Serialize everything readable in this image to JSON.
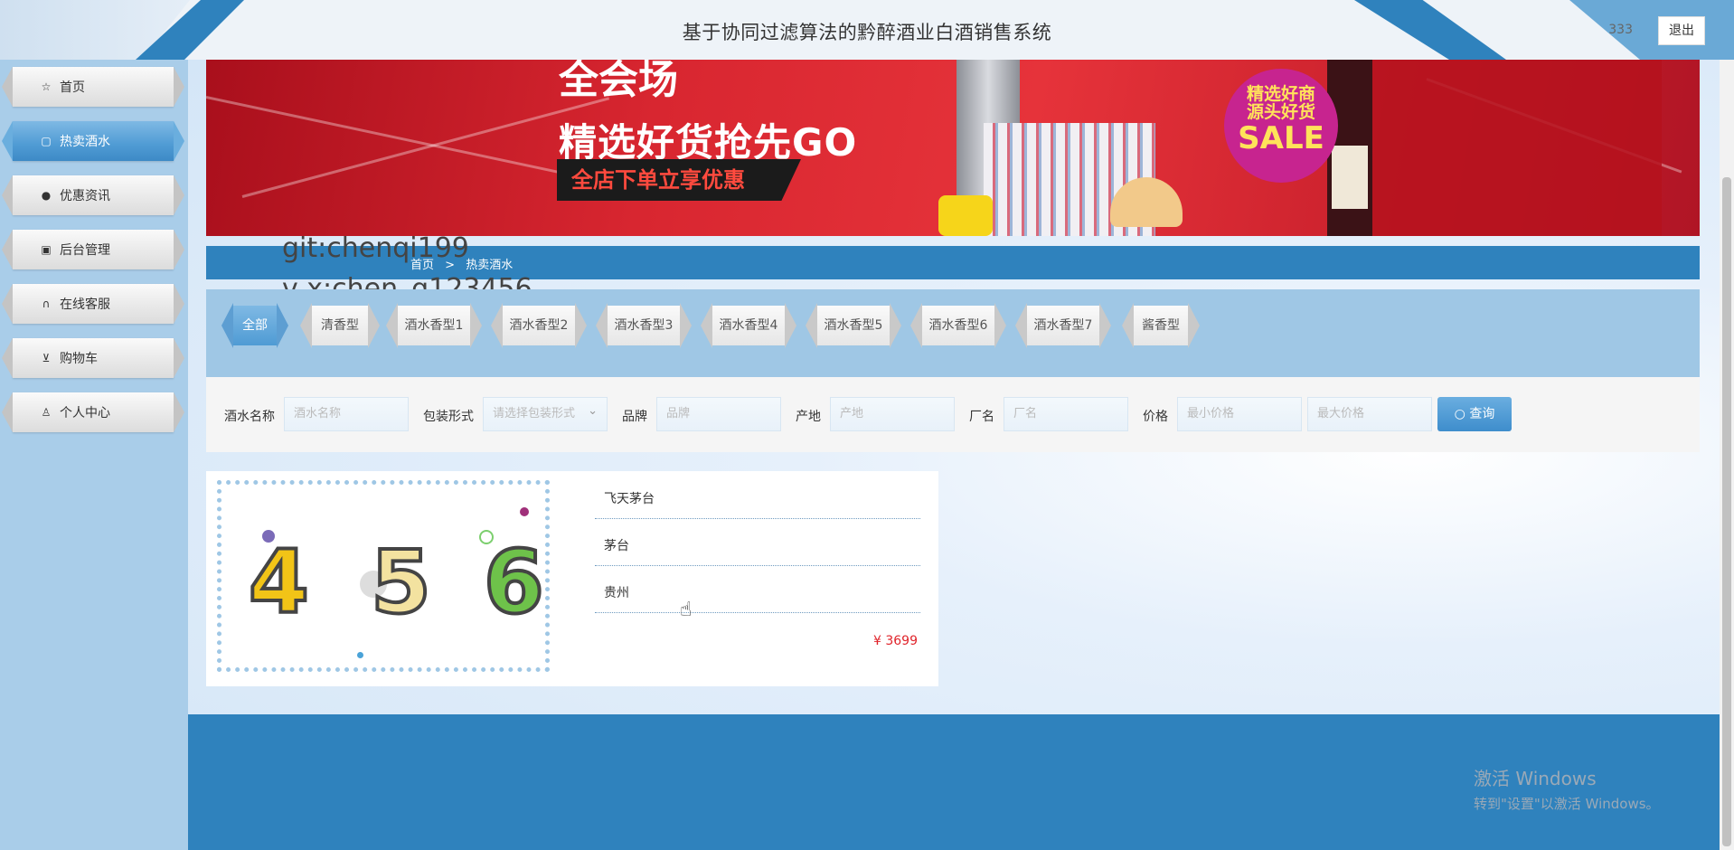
{
  "header": {
    "title": "基于协同过滤算法的黔醉酒业白酒销售系统",
    "username": "333",
    "logout_label": "退出"
  },
  "sidebar": {
    "items": [
      {
        "label": "首页",
        "icon": "star-icon",
        "active": false
      },
      {
        "label": "热卖酒水",
        "icon": "bag-icon",
        "active": true
      },
      {
        "label": "优惠资讯",
        "icon": "info-icon",
        "active": false
      },
      {
        "label": "后台管理",
        "icon": "gift-icon",
        "active": false
      },
      {
        "label": "在线客服",
        "icon": "headset-icon",
        "active": false
      },
      {
        "label": "购物车",
        "icon": "cart-icon",
        "active": false
      },
      {
        "label": "个人中心",
        "icon": "user-icon",
        "active": false
      }
    ]
  },
  "banner": {
    "line1": "全会场",
    "line2": "精选好货抢先GO",
    "tag": "全店下单立享优惠",
    "sale_line1": "精选好商",
    "sale_line2": "源头好货",
    "sale_line3": "SALE"
  },
  "breadcrumb": {
    "home": "首页",
    "separator": ">",
    "current": "热卖酒水"
  },
  "watermark": {
    "line1": "git:chenqi199",
    "line2": "v x:chen_q123456"
  },
  "tabs": [
    {
      "label": "全部",
      "active": true
    },
    {
      "label": "清香型",
      "active": false
    },
    {
      "label": "酒水香型1",
      "active": false
    },
    {
      "label": "酒水香型2",
      "active": false
    },
    {
      "label": "酒水香型3",
      "active": false
    },
    {
      "label": "酒水香型4",
      "active": false
    },
    {
      "label": "酒水香型5",
      "active": false
    },
    {
      "label": "酒水香型6",
      "active": false
    },
    {
      "label": "酒水香型7",
      "active": false
    },
    {
      "label": "酱香型",
      "active": false
    }
  ],
  "search": {
    "name_label": "酒水名称",
    "name_placeholder": "酒水名称",
    "package_label": "包装形式",
    "package_placeholder": "请选择包装形式",
    "brand_label": "品牌",
    "brand_placeholder": "品牌",
    "origin_label": "产地",
    "origin_placeholder": "产地",
    "factory_label": "厂名",
    "factory_placeholder": "厂名",
    "price_label": "价格",
    "min_price_placeholder": "最小价格",
    "max_price_placeholder": "最大价格",
    "submit_label": "查询"
  },
  "products": [
    {
      "name": "飞天茅台",
      "brand": "茅台",
      "origin": "贵州",
      "price": "¥ 3699",
      "image_digits": [
        "4",
        "5",
        "6"
      ]
    }
  ],
  "windows_activation": {
    "line1": "激活 Windows",
    "line2": "转到\"设置\"以激活 Windows。"
  },
  "colors": {
    "primary_blue": "#2f82bd",
    "sidebar_bg": "#a9cde9",
    "price_red": "#e0242b"
  }
}
